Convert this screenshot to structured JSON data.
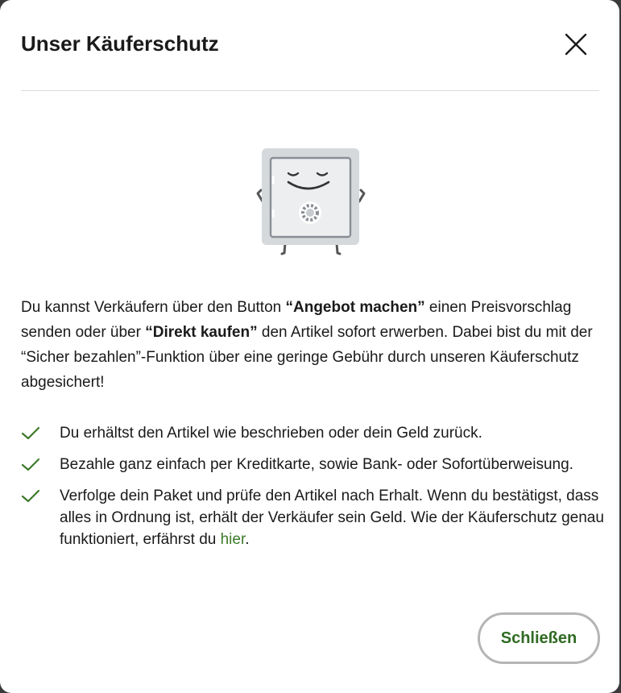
{
  "modal": {
    "title": "Unser Käuferschutz",
    "close_icon": "close-icon",
    "illustration": "smiling-safe-illustration"
  },
  "intro": {
    "part1": "Du kannst Verkäufern über den Button ",
    "bold1": "“Angebot machen”",
    "part2": " einen Preisvorschlag senden oder über ",
    "bold2": "“Direkt kaufen”",
    "part3": " den Artikel sofort erwerben. Dabei bist du mit der “Sicher bezahlen”-Funktion über eine geringe Gebühr durch unseren Käuferschutz abgesichert!"
  },
  "benefits": {
    "icon": "checkmark-icon",
    "items": [
      {
        "text": "Du erhältst den Artikel wie beschrieben oder dein Geld zurück."
      },
      {
        "text": "Bezahle ganz einfach per Kreditkarte, sowie Bank- oder Sofortüberweisung."
      },
      {
        "text": "Verfolge dein Paket und prüfe den Artikel nach Erhalt. Wenn du bestätigst, dass alles in Ordnung ist, erhält der Verkäufer sein Geld. Wie der Käuferschutz genau funktioniert, erfährst du ",
        "link": "hier",
        "after": "."
      }
    ]
  },
  "footer": {
    "close_label": "Schließen"
  },
  "colors": {
    "accent": "#3d7a2a",
    "button_text": "#2f6b22",
    "button_border": "#b5b5b5",
    "divider": "#dcdcdc",
    "safe_body": "#d6d9dc",
    "safe_door": "#edeef0",
    "safe_lines": "#8a8f96"
  }
}
